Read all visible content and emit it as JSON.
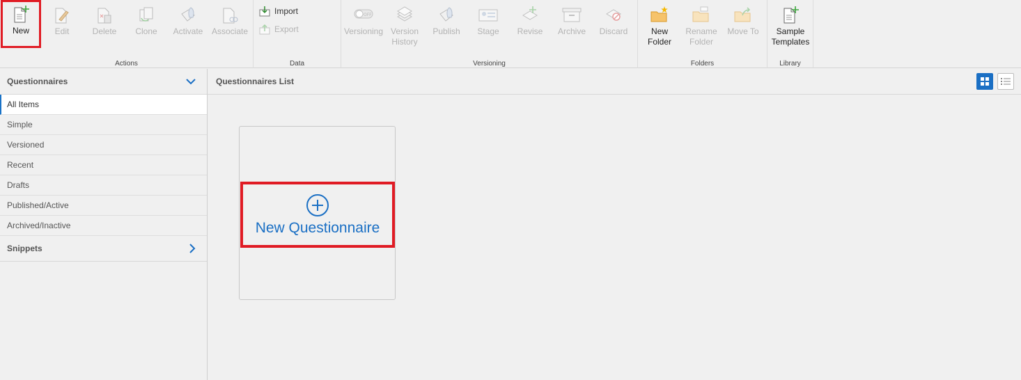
{
  "ribbon": {
    "actions": {
      "label": "Actions",
      "buttons": [
        "New",
        "Edit",
        "Delete",
        "Clone",
        "Activate",
        "Associate"
      ]
    },
    "data": {
      "label": "Data",
      "import": "Import",
      "export": "Export"
    },
    "versioning": {
      "label": "Versioning",
      "buttons": [
        {
          "line1": "Versioning",
          "line2": ""
        },
        {
          "line1": "Version",
          "line2": "History"
        },
        {
          "line1": "Publish",
          "line2": ""
        },
        {
          "line1": "Stage",
          "line2": ""
        },
        {
          "line1": "Revise",
          "line2": ""
        },
        {
          "line1": "Archive",
          "line2": ""
        },
        {
          "line1": "Discard",
          "line2": ""
        }
      ]
    },
    "folders": {
      "label": "Folders",
      "buttons": [
        {
          "line1": "New",
          "line2": "Folder"
        },
        {
          "line1": "Rename",
          "line2": "Folder"
        },
        {
          "line1": "Move To",
          "line2": ""
        }
      ]
    },
    "library": {
      "label": "Library",
      "button": {
        "line1": "Sample",
        "line2": "Templates"
      }
    }
  },
  "sidebar": {
    "title": "Questionnaires",
    "items": [
      "All Items",
      "Simple",
      "Versioned",
      "Recent",
      "Drafts",
      "Published/Active",
      "Archived/Inactive"
    ],
    "snippets": "Snippets"
  },
  "main": {
    "title": "Questionnaires List",
    "new_card_label": "New Questionnaire"
  },
  "colors": {
    "accent": "#1a6fc4",
    "highlight": "#e01b24",
    "disabled": "#b3b3b3"
  }
}
